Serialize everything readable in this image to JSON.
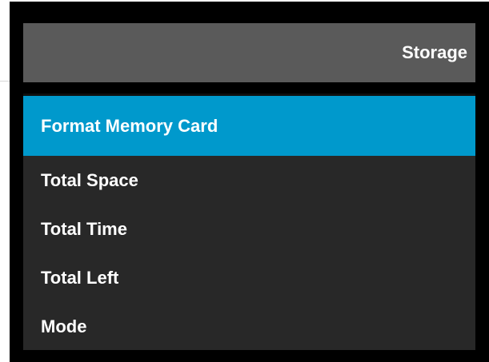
{
  "header": {
    "title": "Storage"
  },
  "menu": {
    "selected_index": 0,
    "items": [
      {
        "label": "Format Memory Card"
      },
      {
        "label": "Total Space"
      },
      {
        "label": "Total Time"
      },
      {
        "label": "Total Left"
      },
      {
        "label": "Mode"
      }
    ]
  },
  "colors": {
    "background": "#000000",
    "header": "#5a5a5a",
    "menu": "#282828",
    "selected": "#0099cc",
    "text": "#ffffff"
  }
}
